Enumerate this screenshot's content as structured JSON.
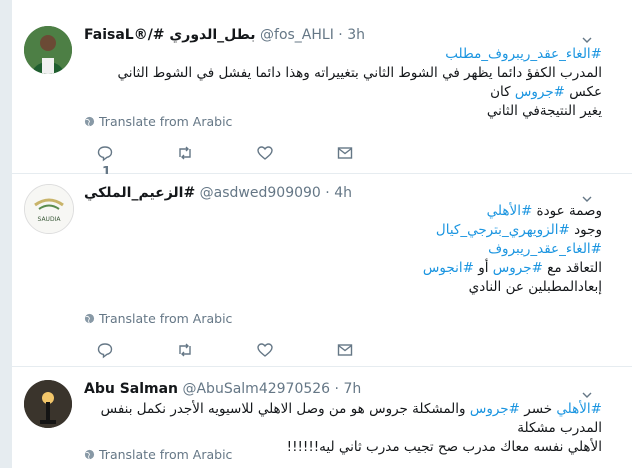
{
  "tweets": [
    {
      "display_name": "FaisaL®/# بطل_الدوري",
      "handle": "@fos_AHLI",
      "separator": "·",
      "time": "3h",
      "lines": [
        [
          {
            "t": "#الغاء_عقد_ريبروف_مطلب",
            "h": true
          }
        ],
        [
          {
            "t": "المدرب الكفؤ دائما يظهر في الشوط الثاني بتغييراته وهذا دائما يفشل في الشوط الثاني عكس ",
            "h": false
          },
          {
            "t": "#جروس",
            "h": true
          },
          {
            "t": " كان",
            "h": false
          }
        ],
        [
          {
            "t": "يغير النتيجةفي الثاني",
            "h": false
          }
        ]
      ],
      "translate_label": "Translate from Arabic",
      "reply_count": "1"
    },
    {
      "display_name": "الزعيم_الملكي#",
      "handle": "@asdwed909090",
      "separator": "·",
      "time": "4h",
      "avatar_text": "SAUDIA",
      "lines": [
        [
          {
            "t": "وصمة عودة ",
            "h": false
          },
          {
            "t": "#الأهلي",
            "h": true
          }
        ],
        [
          {
            "t": "وجود ",
            "h": false
          },
          {
            "t": "#الزويهري_بترجي_كيال",
            "h": true
          }
        ],
        [
          {
            "t": "#الغاء_عقد_ريبروف",
            "h": true
          }
        ],
        [
          {
            "t": "التعاقد مع ",
            "h": false
          },
          {
            "t": "#جروس",
            "h": true
          },
          {
            "t": " أو ",
            "h": false
          },
          {
            "t": "#انجوس",
            "h": true
          }
        ],
        [
          {
            "t": "إبعادالمطبلين عن النادي",
            "h": false
          }
        ]
      ],
      "translate_label": "Translate from Arabic"
    },
    {
      "display_name": "Abu Salman",
      "handle": "@AbuSalm42970526",
      "separator": "·",
      "time": "7h",
      "lines": [
        [
          {
            "t": "#الأهلي",
            "h": true
          },
          {
            "t": " خسر ",
            "h": false
          },
          {
            "t": "#جروس",
            "h": true
          },
          {
            "t": " والمشكلة جروس هو من وصل الاهلي للاسيويه الأجدر نكمل بنفس المدرب مشكلة",
            "h": false
          }
        ],
        [
          {
            "t": "الأهلي نفسه معاك مدرب صح تجيب مدرب ثاني ليه!!!!!!",
            "h": false
          }
        ]
      ],
      "translate_label": "Translate from Arabic"
    }
  ],
  "colors": {
    "hashtag": "#1b95e0",
    "muted": "#657786",
    "divider": "#e6ecf0"
  }
}
